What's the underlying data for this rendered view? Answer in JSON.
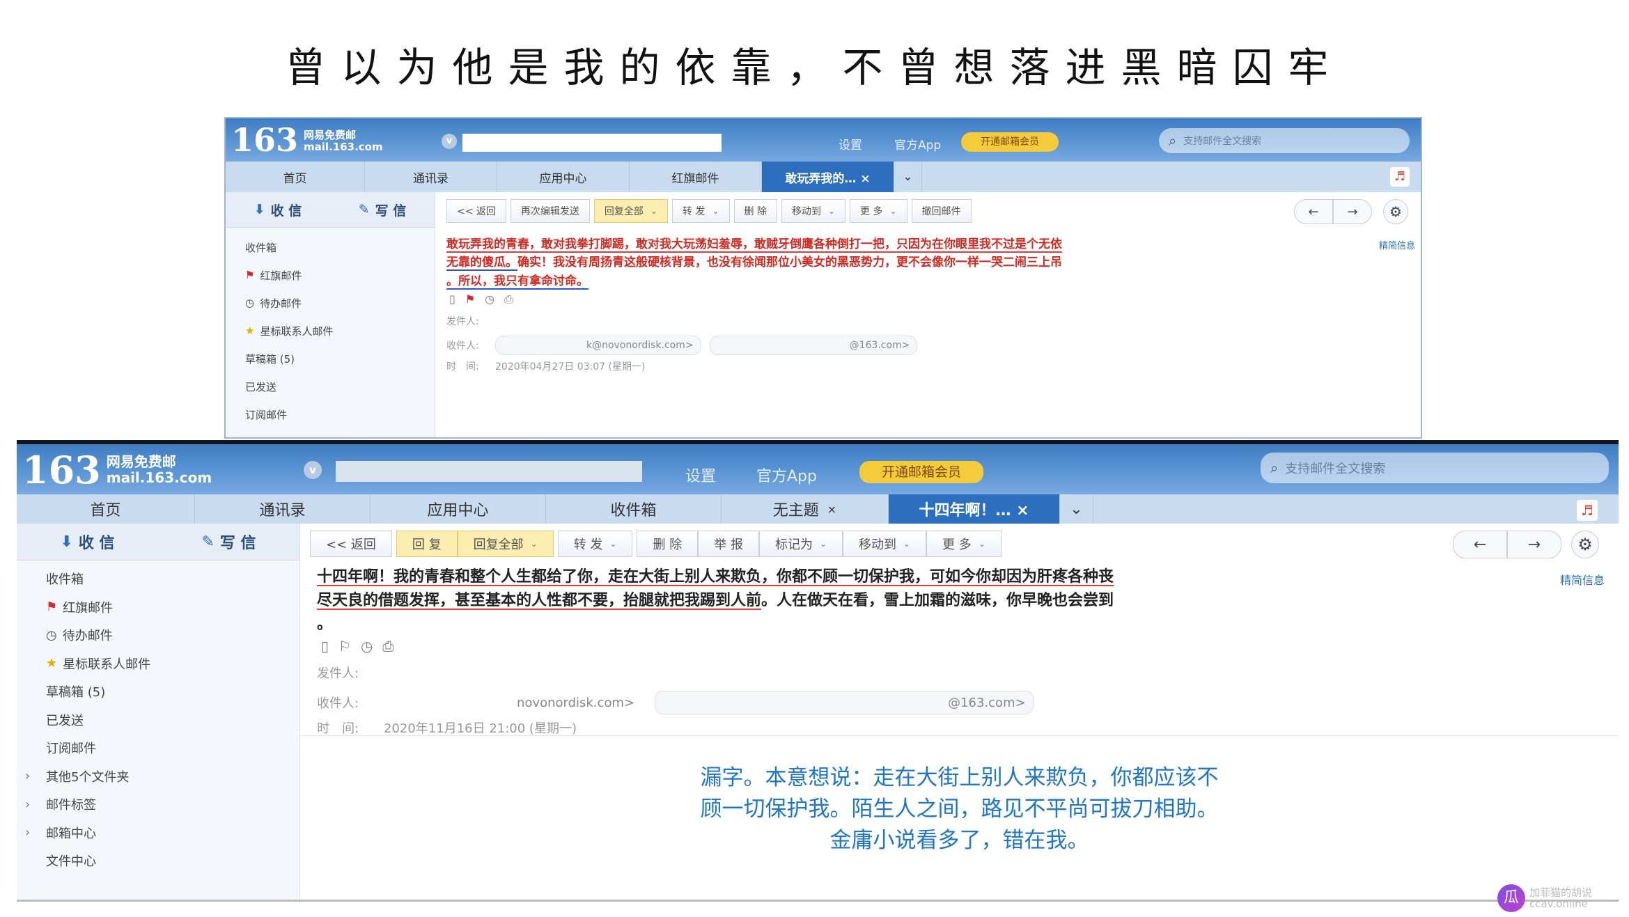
{
  "slide_title": "曾以为他是我的依靠，不曾想落进黑暗囚牢",
  "top_mail": {
    "logo_number": "163",
    "logo_cn": "网易免费邮",
    "logo_domain": "mail.163.com",
    "header_links": [
      "设置",
      "官方App"
    ],
    "vip_button": "开通邮箱会员",
    "search_placeholder": "支持邮件全文搜索",
    "tabs": [
      "首页",
      "通讯录",
      "应用中心",
      "红旗邮件",
      "敢玩弄我的… ×"
    ],
    "compose": {
      "receive": "收 信",
      "write": "写 信"
    },
    "folders": [
      "收件箱",
      "红旗邮件",
      "待办邮件",
      "星标联系人邮件",
      "草稿箱 (5)",
      "已发送",
      "订阅邮件"
    ],
    "toolbar": [
      "<< 返回",
      "再次编辑发送",
      "回复全部",
      "转 发",
      "删 除",
      "移动到",
      "更 多",
      "撤回邮件"
    ],
    "subject_line1": "敢玩弄我的青春，敢对我拳打脚踢，敢对我大玩荡妇羞辱，敢贼牙倒鹰各种倒打一把，只因为在你眼里我不过是个无依",
    "subject_line2_a": "无靠的傻瓜。",
    "subject_line2_b": "确实！我没有周扬青这般硬核背景，也没有徐闻那位小美女的黑恶势力，更不会像你一样一哭二闹三上吊",
    "subject_line3": "。所以，我只有拿命讨命。",
    "detail_link": "精简信息",
    "sender_label": "发件人:",
    "receiver_label": "收件人:",
    "receiver_1": "k@novonordisk.com>",
    "receiver_2": "@163.com>",
    "time_label": "时　间:",
    "time_value": "2020年04月27日 03:07 (星期一)"
  },
  "bottom_mail": {
    "logo_number": "163",
    "logo_cn": "网易免费邮",
    "logo_domain": "mail.163.com",
    "header_links": [
      "设置",
      "官方App"
    ],
    "vip_button": "开通邮箱会员",
    "search_placeholder": "支持邮件全文搜索",
    "tabs": [
      "首页",
      "通讯录",
      "应用中心",
      "收件箱",
      "无主题",
      "十四年啊！… ×"
    ],
    "compose": {
      "receive": "收 信",
      "write": "写 信"
    },
    "folders": [
      "收件箱",
      "红旗邮件",
      "待办邮件",
      "星标联系人邮件",
      "草稿箱 (5)",
      "已发送",
      "订阅邮件",
      "其他5个文件夹",
      "邮件标签",
      "邮箱中心",
      "文件中心"
    ],
    "toolbar": [
      "<< 返回",
      "回 复",
      "回复全部",
      "转 发",
      "删 除",
      "举 报",
      "标记为",
      "移动到",
      "更 多"
    ],
    "subject_line1": "十四年啊！我的青春和整个人生都给了你，走在大街上别人来欺负，你都不顾一切保护我，可如今你却因为肝疼各种丧",
    "subject_line2_a": "尽天良的借题发挥，甚至基本的人性都不要，抬腿就把我踢到人前",
    "subject_line2_b": "。人在做天在看，雪上加霜的滋味，你早晚也会尝到",
    "subject_line3": "。",
    "detail_link": "精简信息",
    "sender_label": "发件人:",
    "receiver_label": "收件人:",
    "receiver_1": "novonordisk.com>",
    "receiver_2": "@163.com>",
    "time_label": "时　间:",
    "time_value": "2020年11月16日 21:00 (星期一)"
  },
  "annotation": [
    "漏字。本意想说：走在大街上别人来欺负，你都应该不",
    "顾一切保护我。陌生人之间，路见不平尚可拔刀相助。",
    "金庸小说看多了，错在我。"
  ],
  "watermark": [
    "加菲猫的胡说",
    "ccav.online"
  ],
  "colors": {
    "accent_blue": "#2c6fbf",
    "underline_red": "#e53a3a",
    "underline_blue": "#2659c9",
    "note_blue": "#1d76c6",
    "subject_red": "#d12a22"
  }
}
